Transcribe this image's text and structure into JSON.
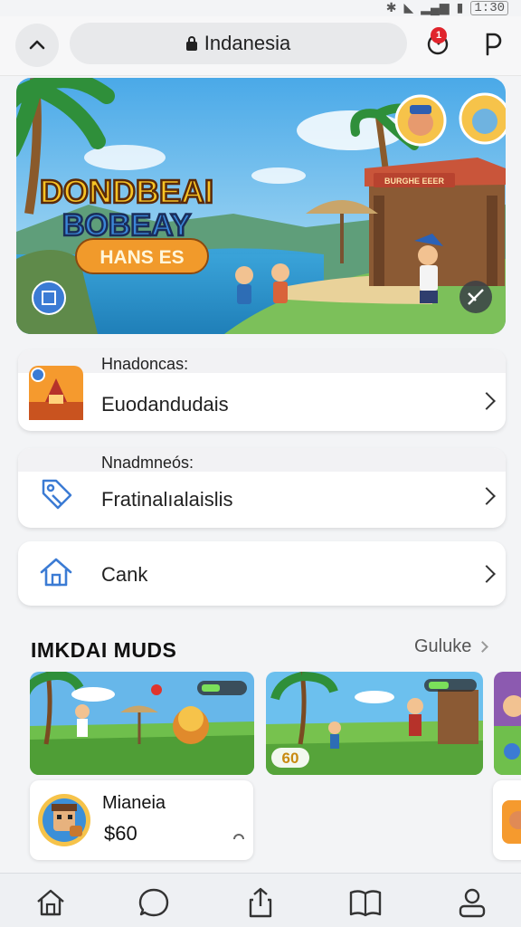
{
  "status_bar": {
    "time": "1:30"
  },
  "browser": {
    "url_text": "Indanesia",
    "notification_count": "1"
  },
  "hero": {
    "title_line1": "DONDBEAI",
    "title_line2": "BOBEAY",
    "button_label": "HANS ES",
    "shop_sign": "BURGHE EEER"
  },
  "cards": [
    {
      "caption": "Hnadoncas:",
      "label": "Euodandudais",
      "icon": "temple-game-icon"
    },
    {
      "caption": "Nnadmneós:",
      "label": "Fratinalıalaislis",
      "icon": "tag-icon"
    },
    {
      "caption": "",
      "label": "Cank",
      "icon": "home-icon"
    }
  ],
  "section": {
    "title": "IMKDAI MUDS",
    "link_label": "Guluke"
  },
  "thumbnails": [
    {
      "name": "game-thumbnail-1"
    },
    {
      "name": "game-thumbnail-2",
      "badge": "60"
    },
    {
      "name": "game-thumbnail-3"
    }
  ],
  "featured_game": {
    "name": "Mianeia",
    "price": "$60"
  },
  "bottom_nav": [
    "home-icon",
    "chat-icon",
    "share-icon",
    "book-icon",
    "profile-icon"
  ],
  "colors": {
    "accent_blue": "#3b7bd4",
    "badge_red": "#e0242c",
    "hero_sky": "#5db8ec"
  }
}
